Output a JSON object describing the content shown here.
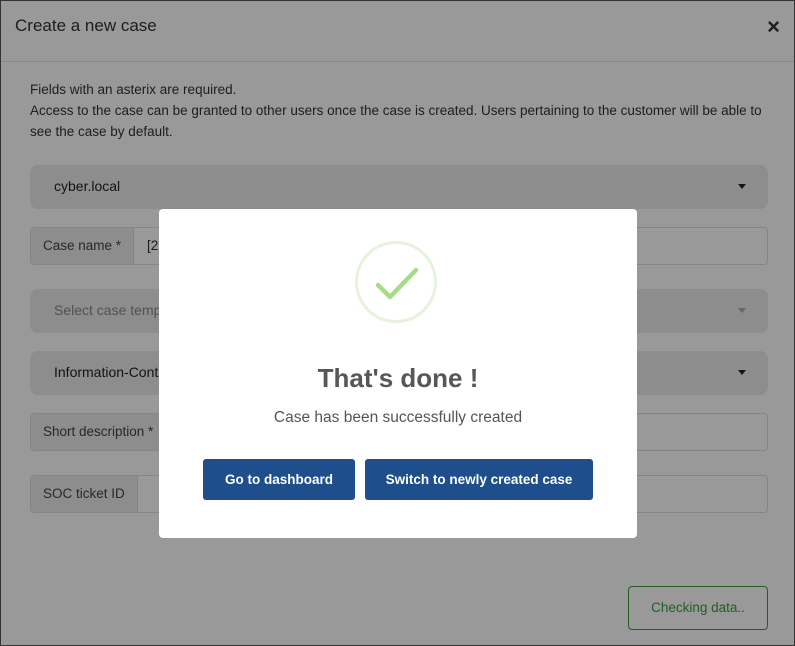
{
  "modal": {
    "title": "Create a new case",
    "close_glyph": "×",
    "intro_line1": "Fields with an asterix are required.",
    "intro_line2": "Access to the case can be granted to other users once the case is created. Users pertaining to the customer will be able to see the case by default."
  },
  "form": {
    "customer_select": "cyber.local",
    "case_name_label": "Case name *",
    "case_name_value": "[2",
    "template_select_placeholder": "Select case templ",
    "classification_select": "Information-Cont",
    "short_description_label": "Short description *",
    "soc_ticket_label": "SOC ticket ID"
  },
  "footer": {
    "checking_label": "Checking data.."
  },
  "dialog": {
    "icon": "success-check-icon",
    "title": "That's done !",
    "text": "Case has been successfully created",
    "btn_dashboard": "Go to dashboard",
    "btn_switch": "Switch to newly created case"
  },
  "colors": {
    "primary": "#1e4e8c",
    "success": "#3a9d3a",
    "check": "#a5dc86"
  }
}
